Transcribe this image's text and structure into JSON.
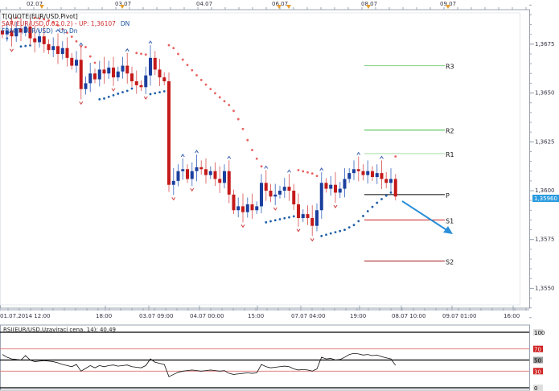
{
  "legend": {
    "quote": "T[QUOTE(EUR/USD,Pivot]",
    "sar": "SAR(EUR/USD,0.02,0.2) - UP: 1,36107",
    "sar_dn": "DN",
    "fractal": "FRACT(EUR/USD) - Up Dn"
  },
  "current_price": "1,35960",
  "top_dates": [
    "02.07",
    "03.07",
    "04.07",
    "06.07",
    "08.07",
    "09.07"
  ],
  "rsi_legend": "RSI(EUR/USD,Uzavírací cena, 14): 40,49",
  "colors": {
    "up": "#1b3f9e",
    "down": "#c41a1a",
    "sar_up": "#1f5fa8",
    "sar_down": "#e86060",
    "price_box": "#2a9be0",
    "trend_arrow": "#2a8fd8"
  },
  "chart_data": {
    "type": "candlestick",
    "symbol": "EUR/USD",
    "yticks": [
      "1,3675",
      "1,3650",
      "1,3625",
      "1,3600",
      "1,3575",
      "1,3550"
    ],
    "ytick_values": [
      1.3675,
      1.365,
      1.3625,
      1.36,
      1.3575,
      1.355
    ],
    "ylim": [
      1.3532,
      1.3704
    ],
    "xticks": [
      "01.07.2014 12:00",
      "18:00",
      "03.07 09:00",
      "04.07 00:00",
      "15:00",
      "07.07 04:00",
      "19:00",
      "08.07 10:00",
      "09.07 01:00",
      "16:00"
    ],
    "closes": [
      1.368,
      1.3682,
      1.3679,
      1.3683,
      1.3681,
      1.3684,
      1.3678,
      1.3676,
      1.3679,
      1.3675,
      1.3672,
      1.3674,
      1.367,
      1.3673,
      1.3668,
      1.3664,
      1.3667,
      1.3652,
      1.3655,
      1.366,
      1.3657,
      1.3662,
      1.366,
      1.3663,
      1.3658,
      1.3661,
      1.3664,
      1.366,
      1.3656,
      1.3654,
      1.3653,
      1.3659,
      1.3668,
      1.3662,
      1.3658,
      1.3656,
      1.3603,
      1.3605,
      1.361,
      1.3611,
      1.3606,
      1.361,
      1.3612,
      1.3611,
      1.3608,
      1.361,
      1.3606,
      1.3604,
      1.361,
      1.3598,
      1.359,
      1.3592,
      1.3589,
      1.3593,
      1.359,
      1.3592,
      1.3604,
      1.36,
      1.3597,
      1.3598,
      1.36,
      1.3602,
      1.36,
      1.3593,
      1.3586,
      1.3588,
      1.3586,
      1.3582,
      1.359,
      1.3604,
      1.3601,
      1.3603,
      1.3599,
      1.3601,
      1.3606,
      1.3609,
      1.3611,
      1.361,
      1.3608,
      1.361,
      1.3607,
      1.3609,
      1.3606,
      1.3604,
      1.3606,
      1.3597
    ],
    "pivots": [
      {
        "label": "R3",
        "value": 1.3664,
        "color": "#7fd07f"
      },
      {
        "label": "R2",
        "value": 1.3631,
        "color": "#3cb83c"
      },
      {
        "label": "R1",
        "value": 1.3619,
        "color": "#a8e0a8"
      },
      {
        "label": "P",
        "value": 1.3598,
        "color": "#000000"
      },
      {
        "label": "S1",
        "value": 1.3585,
        "color": "#cc2020"
      },
      {
        "label": "S2",
        "value": 1.3564,
        "color": "#a01818"
      }
    ],
    "rsi": {
      "period": 14,
      "levels": [
        "100",
        "70",
        "50",
        "30",
        "0"
      ],
      "level_values": [
        100,
        70,
        50,
        30,
        0
      ],
      "values": [
        60,
        55,
        52,
        51,
        50,
        58,
        50,
        47,
        48,
        49,
        48,
        47,
        45,
        42,
        40,
        38,
        42,
        30,
        35,
        40,
        36,
        40,
        38,
        40,
        41,
        39,
        40,
        41,
        38,
        37,
        36,
        40,
        52,
        46,
        44,
        42,
        20,
        24,
        28,
        30,
        31,
        32,
        31,
        30,
        31,
        32,
        31,
        30,
        31,
        26,
        24,
        25,
        26,
        27,
        26,
        27,
        42,
        38,
        36,
        37,
        38,
        39,
        38,
        34,
        32,
        33,
        32,
        30,
        34,
        55,
        52,
        53,
        50,
        51,
        55,
        60,
        62,
        61,
        59,
        60,
        58,
        59,
        56,
        54,
        52,
        40.49
      ]
    }
  }
}
